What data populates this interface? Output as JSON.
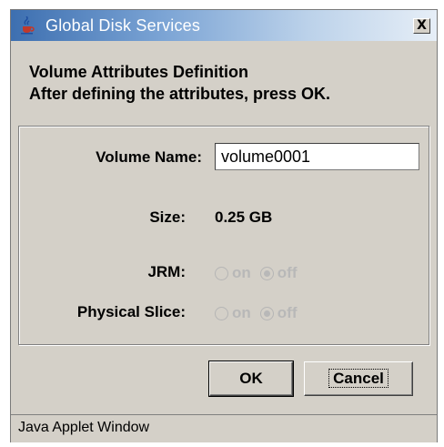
{
  "window": {
    "title": "Global Disk Services",
    "close_glyph": "X"
  },
  "heading": {
    "line1": "Volume Attributes Definition",
    "line2": "After defining the attributes, press OK."
  },
  "form": {
    "volume_name_label": "Volume Name:",
    "volume_name_value": "volume0001",
    "size_label": "Size:",
    "size_value": "0.25 GB",
    "jrm_label": "JRM:",
    "physical_slice_label": "Physical Slice:",
    "radio_on_label": "on",
    "radio_off_label": "off",
    "jrm_selected": "off",
    "physical_slice_selected": "off"
  },
  "buttons": {
    "ok": "OK",
    "cancel": "Cancel"
  },
  "status": {
    "text": "Java Applet Window"
  },
  "colors": {
    "title_gradient_start": "#3d6fb0",
    "disabled_text": "#b8b8b8",
    "window_bg": "#d4d0c8"
  },
  "icons": {
    "app": "java-cup-icon",
    "close": "close-icon"
  }
}
